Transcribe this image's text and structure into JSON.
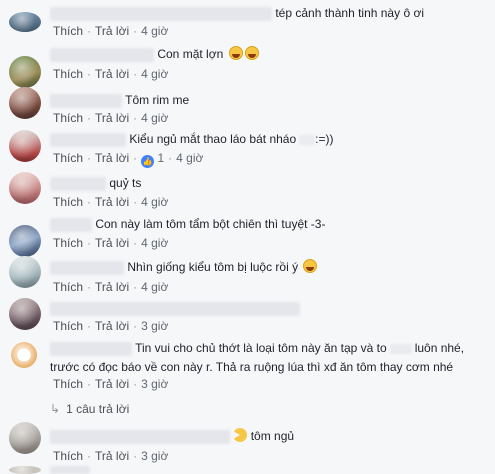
{
  "actions": {
    "like": "Thích",
    "reply": "Trả lời",
    "sep": "·"
  },
  "comments": [
    {
      "text": "tép cảnh thành tinh này ô ơi",
      "time": "4 giờ"
    },
    {
      "text": "Con mặt lợn",
      "time": "4 giờ"
    },
    {
      "text": "Tôm rim me",
      "time": "4 giờ"
    },
    {
      "text": "Kiểu ngủ mắt thao láo bát nháo",
      "text_end": ":=))",
      "likes": "1",
      "time": "4 giờ"
    },
    {
      "text": "quỷ ts",
      "time": "4 giờ"
    },
    {
      "text": "Con này làm tôm tẩm bột chiên thì tuyệt -3-",
      "time": "4 giờ"
    },
    {
      "text": "Nhìn giống kiểu tôm bị luộc rồi ý",
      "time": "4 giờ"
    },
    {
      "text": "",
      "time": "3 giờ"
    },
    {
      "line1": "Tin vui cho chủ thớt là loại tôm này ăn tạp và to",
      "line1_end": "luôn nhé,",
      "line2": "trước có đọc báo về con này r. Thả ra ruộng lúa thì xđ ăn tôm thay cơm nhé",
      "time": "3 giờ",
      "replies": "1 câu trả lời"
    },
    {
      "text": "tôm ngủ",
      "time": "3 giờ"
    }
  ],
  "colors": {
    "link": "#4b4f56",
    "meta": "#90949c",
    "like_blue": "#4080ff",
    "bg": "#f6f7f9"
  }
}
